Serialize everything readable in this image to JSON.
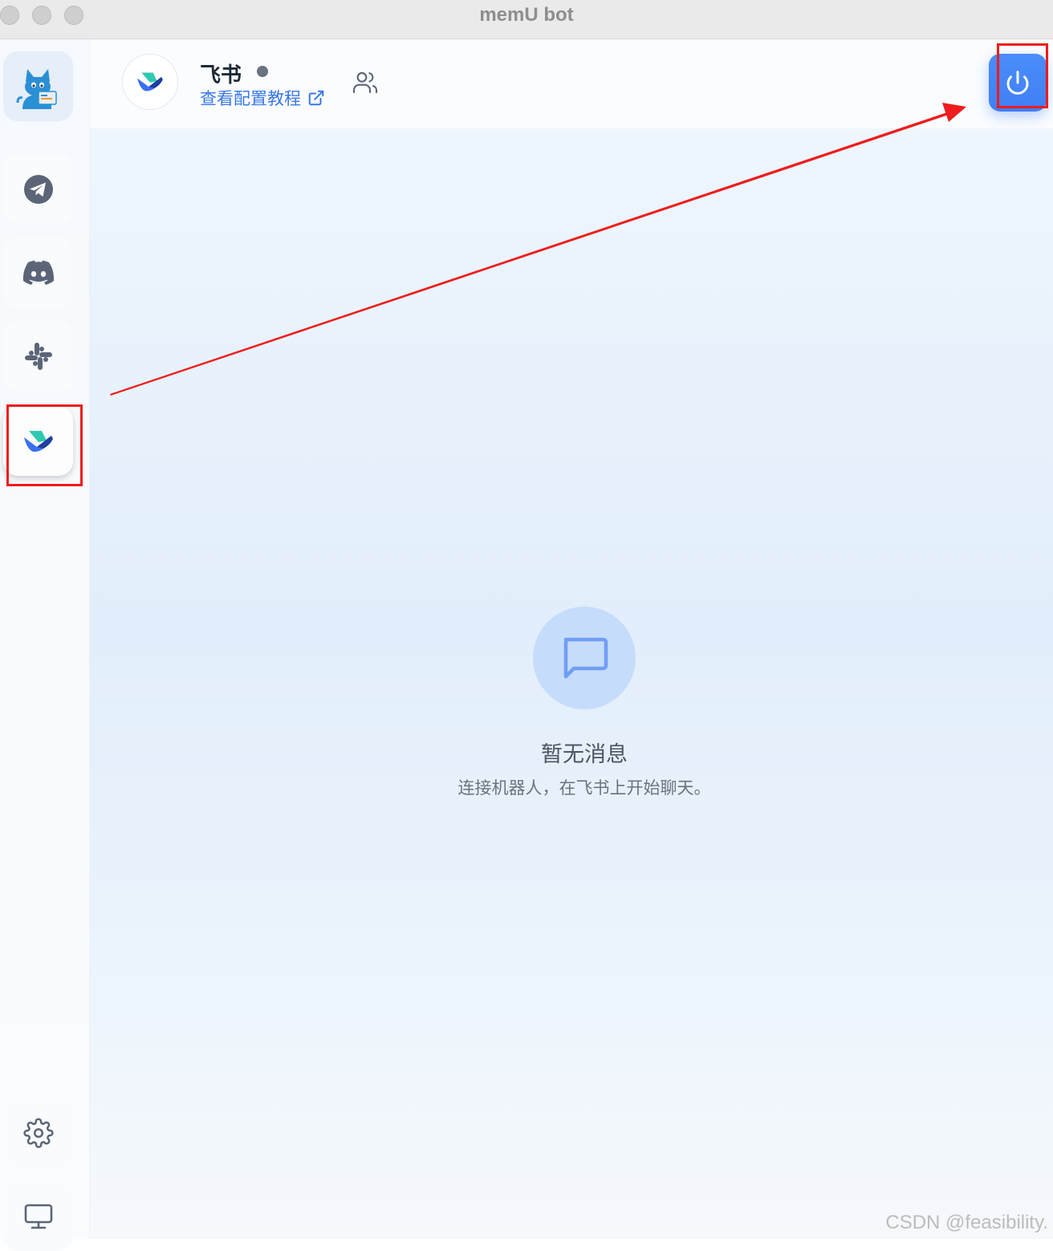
{
  "window": {
    "title": "memU bot"
  },
  "sidebar": {
    "items": [
      {
        "name": "app-logo",
        "icon": "cat-mascot-icon"
      },
      {
        "name": "telegram",
        "icon": "telegram-icon"
      },
      {
        "name": "discord",
        "icon": "discord-icon"
      },
      {
        "name": "slack",
        "icon": "slack-icon"
      },
      {
        "name": "feishu",
        "icon": "feishu-icon",
        "active": true
      }
    ],
    "bottom_items": [
      {
        "name": "settings",
        "icon": "gear-icon"
      },
      {
        "name": "display",
        "icon": "monitor-icon"
      }
    ]
  },
  "header": {
    "title": "飞书",
    "status": "offline",
    "link_text": "查看配置教程",
    "link_icon": "external-link-icon",
    "members_icon": "users-icon",
    "power_icon": "power-icon",
    "power_color": "#4285f4"
  },
  "empty_state": {
    "icon": "message-square-icon",
    "title": "暂无消息",
    "subtitle": "连接机器人，在飞书上开始聊天。"
  },
  "annotations": {
    "highlight_color": "#ee1c1c"
  },
  "watermark": "CSDN @feasibility."
}
